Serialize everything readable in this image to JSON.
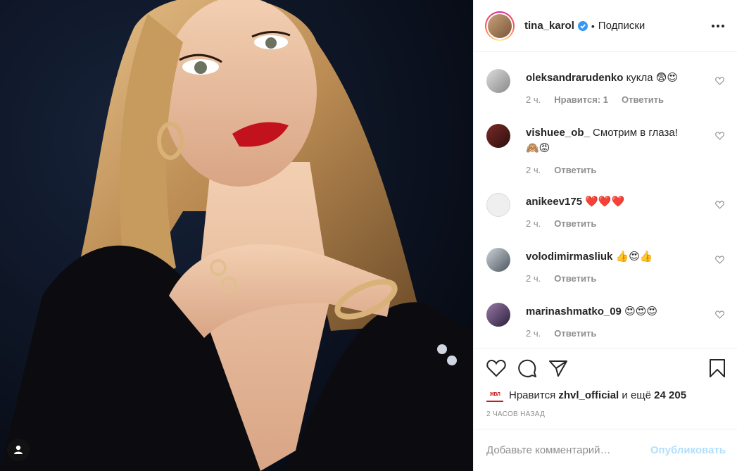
{
  "header": {
    "username": "tina_karol",
    "separator": "•",
    "follow_label": "Подписки"
  },
  "comments": [
    {
      "user": "oleksandrarudenko",
      "text": "кукла",
      "emoji": "😨😍",
      "time": "2 ч.",
      "likes": "Нравится: 1",
      "reply": "Ответить"
    },
    {
      "user": "vishuee_ob_",
      "text": "Смотрим в глаза!",
      "emoji": "🙈😡",
      "time": "2 ч.",
      "reply": "Ответить"
    },
    {
      "user": "anikeev175",
      "text": "",
      "emoji": "❤️❤️❤️",
      "time": "2 ч.",
      "reply": "Ответить"
    },
    {
      "user": "volodimirmasliuk",
      "text": "",
      "emoji": "👍😍👍",
      "time": "2 ч.",
      "reply": "Ответить"
    },
    {
      "user": "marinashmatko_09",
      "text": "",
      "emoji": "😍😍😍",
      "time": "2 ч.",
      "reply": "Ответить"
    }
  ],
  "likes": {
    "avatar_text": "ЖВЛ",
    "prefix": "Нравится",
    "user": "zhvl_official",
    "middle": "и ещё",
    "count": "24 205"
  },
  "timestamp": "2 ЧАСОВ НАЗАД",
  "add_comment": {
    "placeholder": "Добавьте комментарий…",
    "post_label": "Опубликовать"
  },
  "colors": {
    "accent_blue": "#0095f6",
    "post_disabled": "#b2dffc",
    "muted": "#8e8e8e"
  }
}
